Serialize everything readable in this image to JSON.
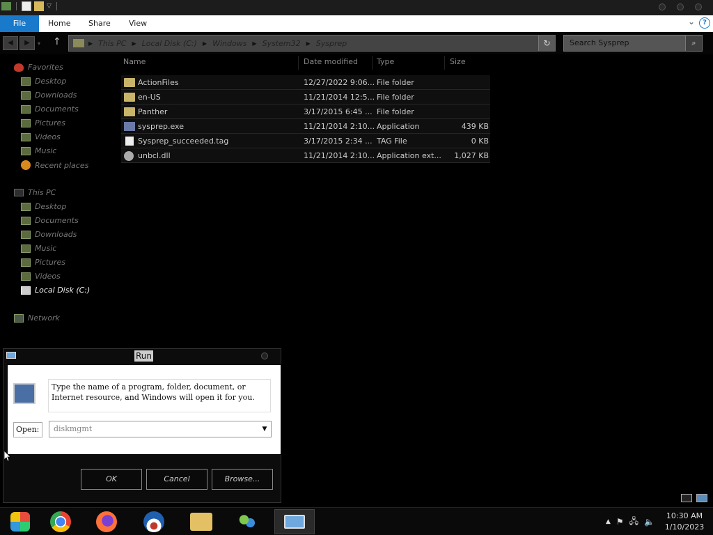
{
  "window": {
    "ribbon_tabs": [
      "File",
      "Home",
      "Share",
      "View"
    ]
  },
  "address": {
    "crumbs": [
      "This PC",
      "Local Disk (C:)",
      "Windows",
      "System32",
      "Sysprep"
    ],
    "search_placeholder": "Search Sysprep"
  },
  "nav": {
    "favorites": "Favorites",
    "fav_items": [
      "Desktop",
      "Downloads",
      "Documents",
      "Pictures",
      "Videos",
      "Music",
      "Recent places"
    ],
    "this_pc": "This PC",
    "pc_items": [
      "Desktop",
      "Documents",
      "Downloads",
      "Music",
      "Pictures",
      "Videos",
      "Local Disk (C:)"
    ],
    "network": "Network"
  },
  "columns": {
    "name": "Name",
    "date": "Date modified",
    "type": "Type",
    "size": "Size"
  },
  "files": [
    {
      "name": "ActionFiles",
      "date": "12/27/2022 9:06...",
      "type": "File folder",
      "size": "",
      "icon": "folder-icon"
    },
    {
      "name": "en-US",
      "date": "11/21/2014 12:5...",
      "type": "File folder",
      "size": "",
      "icon": "folder-icon"
    },
    {
      "name": "Panther",
      "date": "3/17/2015 6:45 ...",
      "type": "File folder",
      "size": "",
      "icon": "folder-icon"
    },
    {
      "name": "sysprep.exe",
      "date": "11/21/2014 2:10...",
      "type": "Application",
      "size": "439 KB",
      "icon": "exe-icon"
    },
    {
      "name": "Sysprep_succeeded.tag",
      "date": "3/17/2015 2:34 ...",
      "type": "TAG File",
      "size": "0 KB",
      "icon": "file-icon"
    },
    {
      "name": "unbcl.dll",
      "date": "11/21/2014 2:10...",
      "type": "Application ext...",
      "size": "1,027 KB",
      "icon": "gear-icon"
    }
  ],
  "run_dialog": {
    "title": "Run",
    "description_line1": "Type the name of a program, folder, document, or",
    "description_line2": "Internet resource, and Windows will open it for you.",
    "open_label": "Open:",
    "open_value": "diskmgmt",
    "ok": "OK",
    "cancel": "Cancel",
    "browse": "Browse..."
  },
  "taskbar": {
    "apps": [
      "start-orb-icon",
      "chrome-icon",
      "firefox-icon",
      "obama-logo-icon",
      "file-explorer-icon",
      "network-people-icon",
      "run-icon"
    ],
    "time": "10:30 AM",
    "date": "1/10/2023"
  }
}
